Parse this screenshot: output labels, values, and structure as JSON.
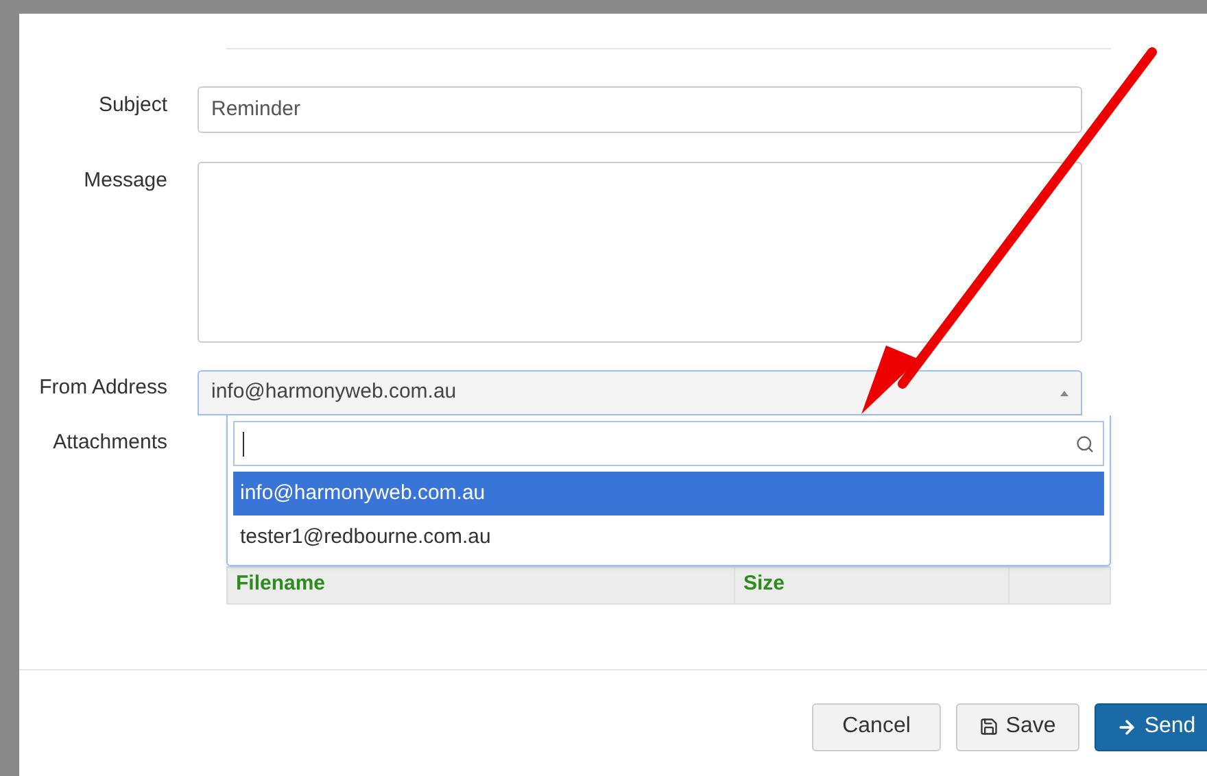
{
  "form": {
    "subject": {
      "label": "Subject",
      "value": "Reminder"
    },
    "message": {
      "label": "Message"
    },
    "from_address": {
      "label": "From Address",
      "value": "info@harmonyweb.com.au",
      "expanded": true,
      "options": [
        {
          "label": "info@harmonyweb.com.au",
          "selected": true
        },
        {
          "label": "tester1@redbourne.com.au",
          "selected": false
        }
      ]
    },
    "attachments": {
      "label": "Attachments",
      "columns": [
        "Filename",
        "Size"
      ]
    }
  },
  "buttons": [
    {
      "kind": "cancel",
      "label": "Cancel"
    },
    {
      "kind": "save",
      "label": "Save"
    },
    {
      "kind": "send",
      "label": "Send"
    }
  ]
}
